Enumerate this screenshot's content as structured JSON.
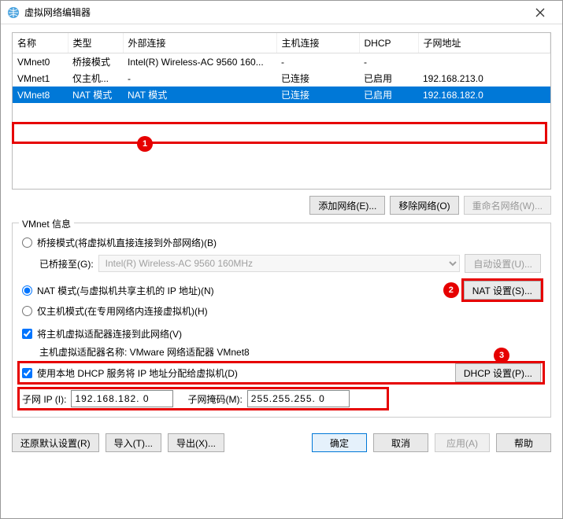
{
  "window": {
    "title": "虚拟网络编辑器"
  },
  "table": {
    "headers": [
      "名称",
      "类型",
      "外部连接",
      "主机连接",
      "DHCP",
      "子网地址"
    ],
    "rows": [
      {
        "cells": [
          "VMnet0",
          "桥接模式",
          "Intel(R) Wireless-AC 9560 160...",
          "-",
          "-",
          ""
        ],
        "selected": false
      },
      {
        "cells": [
          "VMnet1",
          "仅主机...",
          "-",
          "已连接",
          "已启用",
          "192.168.213.0"
        ],
        "selected": false
      },
      {
        "cells": [
          "VMnet8",
          "NAT 模式",
          "NAT 模式",
          "已连接",
          "已启用",
          "192.168.182.0"
        ],
        "selected": true
      }
    ]
  },
  "buttons": {
    "add": "添加网络(E)...",
    "remove": "移除网络(O)",
    "rename": "重命名网络(W)...",
    "autoset": "自动设置(U)...",
    "natset": "NAT 设置(S)...",
    "dhcpset": "DHCP 设置(P)...",
    "restore": "还原默认设置(R)",
    "import": "导入(T)...",
    "export": "导出(X)...",
    "ok": "确定",
    "cancel": "取消",
    "apply": "应用(A)",
    "help": "帮助"
  },
  "info": {
    "legend": "VMnet 信息",
    "bridged": "桥接模式(将虚拟机直接连接到外部网络)(B)",
    "bridged_to_label": "已桥接至(G):",
    "bridged_to_value": "Intel(R) Wireless-AC 9560 160MHz",
    "nat": "NAT 模式(与虚拟机共享主机的 IP 地址)(N)",
    "hostonly": "仅主机模式(在专用网络内连接虚拟机)(H)",
    "connect_host": "将主机虚拟适配器连接到此网络(V)",
    "adapter_label": "主机虚拟适配器名称: VMware 网络适配器 VMnet8",
    "use_dhcp": "使用本地 DHCP 服务将 IP 地址分配给虚拟机(D)",
    "subnet_ip_label": "子网 IP (I):",
    "subnet_ip_value": "192.168.182. 0",
    "subnet_mask_label": "子网掩码(M):",
    "subnet_mask_value": "255.255.255. 0"
  },
  "annotations": {
    "b1": "1",
    "b2": "2",
    "b3": "3"
  }
}
